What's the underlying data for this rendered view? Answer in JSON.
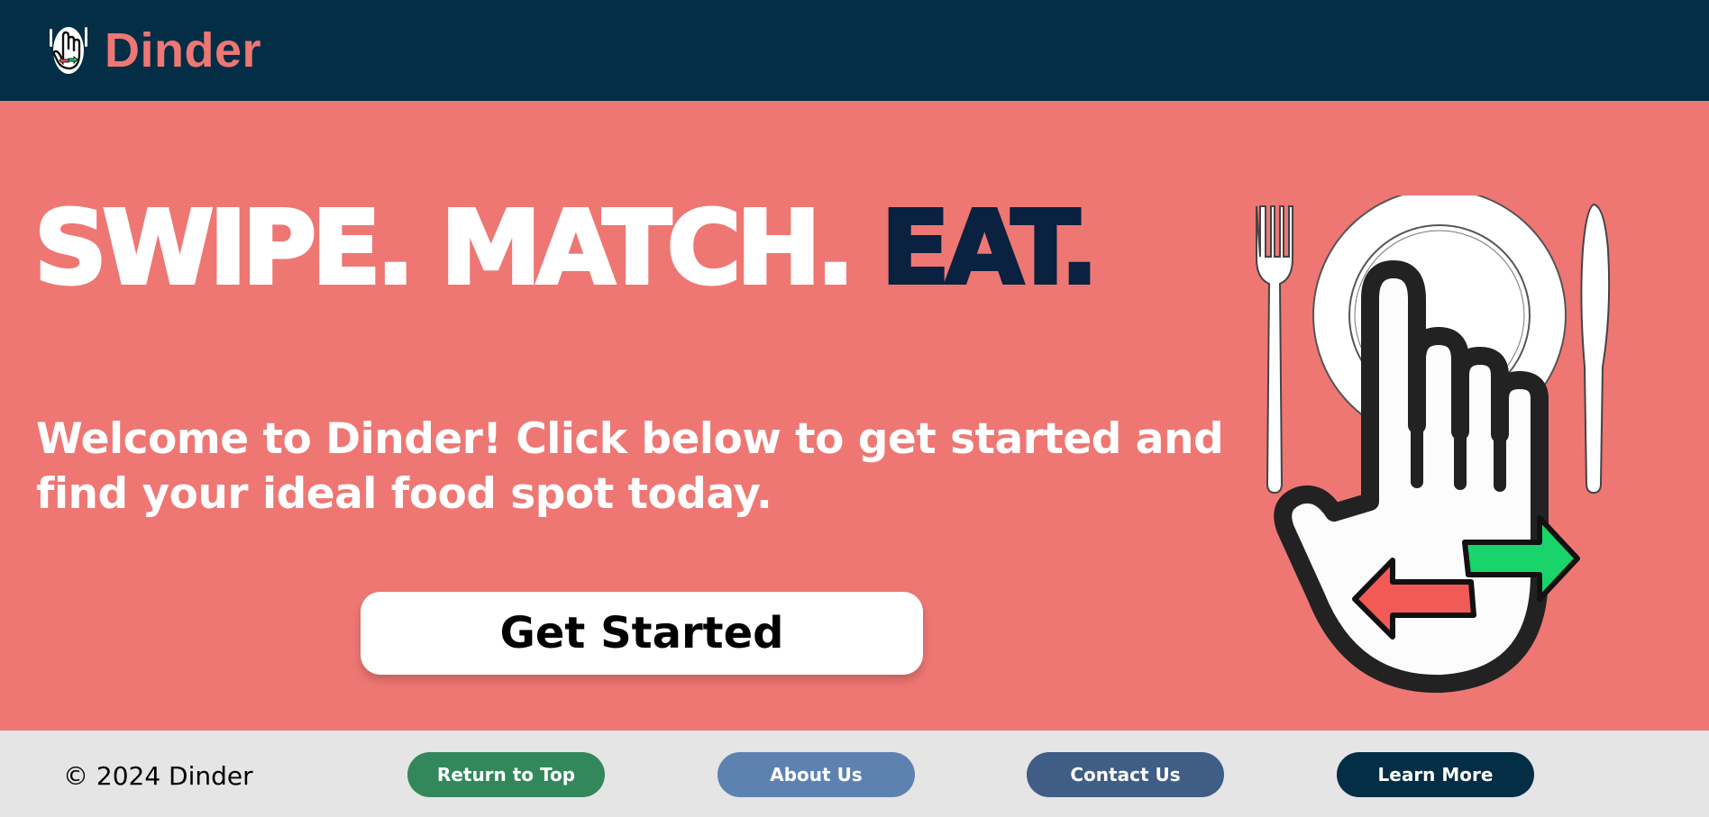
{
  "brand": {
    "name": "Dinder",
    "logo_icon": "hand-swipe-plate-icon"
  },
  "hero": {
    "headline_light": "SWIPE. MATCH. ",
    "headline_dark": "EAT.",
    "subtitle": "Welcome to Dinder! Click below to get started and find your ideal food spot today.",
    "cta_label": "Get Started",
    "illustration": "hand-swipe-plate-illustration"
  },
  "footer": {
    "copyright": "© 2024 Dinder",
    "buttons": {
      "return_top": "Return to Top",
      "about": "About Us",
      "contact": "Contact Us",
      "learn_more": "Learn More"
    }
  },
  "colors": {
    "navbar": "#032e46",
    "hero": "#ee7773",
    "accent_dark": "#0a2140",
    "footer": "#e5e5e5",
    "btn_return": "#32885b",
    "btn_about": "#5d82b2",
    "btn_contact": "#3f5d85",
    "btn_learn": "#032e46",
    "arrow_green": "#18d46a",
    "arrow_red": "#f25a56"
  }
}
